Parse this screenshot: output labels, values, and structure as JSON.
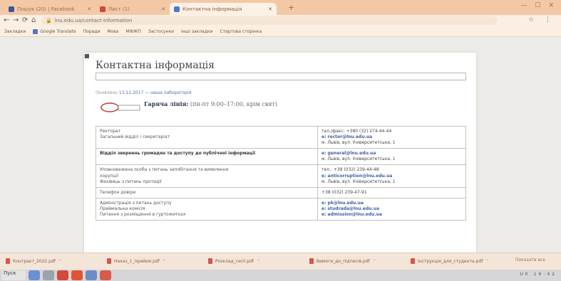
{
  "browser": {
    "tabs": [
      {
        "label": "Пошук (20) | Facebook",
        "color": "#3b5998"
      },
      {
        "label": "Лист (1)",
        "color": "#d44638"
      },
      {
        "label": "Контактна інформація",
        "color": "#4a7cc4"
      }
    ],
    "new_tab": "+",
    "window_controls": "—  ☐  ✕",
    "nav": {
      "back": "←",
      "forward": "→",
      "reload": "⟳",
      "home": "⌂"
    },
    "address": "lnu.edu.ua/contact-information",
    "bookmarks": [
      "Закладки",
      "Google Translate",
      "Поради",
      "Мова",
      "МФЖП",
      "Застосунки",
      "Інші закладки",
      "Стартова сторінка"
    ]
  },
  "page": {
    "title": "Контактна інформація",
    "search_placeholder": "",
    "updated_prefix": "Оновлено",
    "updated_link": "13.12.2017 — наша лабораторія",
    "hotline_bold": "Гаряча лінія:",
    "hotline_rest": " (пн-пт 9:00–17:00, крім свят)",
    "rows": [
      {
        "left": [
          "Ректорат",
          "Загальний відділ / секретаріат"
        ],
        "left_bold": false,
        "right": [
          "тел./факс: +380 (32) 274-44-44",
          "e: rector@lnu.edu.ua",
          "м. Львів, вул. Університетська, 1"
        ]
      },
      {
        "left": [
          "Відділ звернень громадян та доступу до публічної інформації"
        ],
        "left_bold": true,
        "right": [
          "e: general@lnu.edu.ua",
          "м. Львів, вул. Університетська, 1"
        ]
      },
      {
        "left": [
          "Уповноважена особа з питань запобігання та виявлення",
          "корупції",
          "Фахівець з питань протидії"
        ],
        "left_bold": false,
        "right": [
          "тел.: +38 (032) 239-44-48",
          "e: anticorruption@lnu.edu.ua",
          "м. Львів, вул. Університетська, 1"
        ]
      },
      {
        "left": [
          "Телефон довіри"
        ],
        "left_bold": false,
        "right": [
          "+38 (032) 239-47-91"
        ]
      },
      {
        "left": [
          "Адміністрація з питань доступу",
          "Приймальна комісія",
          "Питання з розміщення в гуртожитках"
        ],
        "left_bold": false,
        "right": [
          "e: pk@lnu.edu.ua",
          "e: studrada@lnu.edu.ua",
          "e: admission@lnu.edu.ua"
        ]
      }
    ]
  },
  "downloads": {
    "items": [
      "Контракт_2022.pdf",
      "Наказ_1_прийом.pdf",
      "Розклад_сесії.pdf",
      "Вимоги_до_підписів.pdf",
      "Інструкція_для_студента.pdf"
    ],
    "show_all": "Показати все"
  },
  "taskbar": {
    "start": "Пуск",
    "tray": "UK  16:42"
  }
}
